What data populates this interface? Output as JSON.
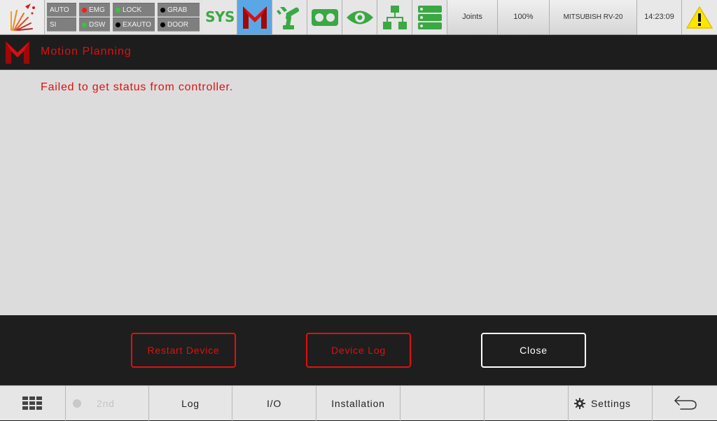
{
  "topbar": {
    "status": {
      "mode_top": "AUTO",
      "mode_bottom": "SI",
      "emg": "EMG",
      "dsw": "DSW",
      "lock": "LOCK",
      "exauto": "EXAUTO",
      "grab": "GRAB",
      "door": "DOOR"
    },
    "sys_label": "SYS",
    "joints_label": "Joints",
    "speed": "100%",
    "robot_name": "MITSUBISH RV-20",
    "time": "14:23:09",
    "icons": [
      "logo-icon",
      "sys-icon",
      "motion-planning-icon",
      "robot-arm-icon",
      "tape-icon",
      "eye-icon",
      "network-icon",
      "list-icon",
      "warning-icon"
    ]
  },
  "title": {
    "text": "Motion Planning"
  },
  "message": {
    "text": "Failed to get status from controller."
  },
  "actions": {
    "restart": "Restart Device",
    "device_log": "Device Log",
    "close": "Close"
  },
  "bottombar": {
    "second": "2nd",
    "log": "Log",
    "io": "I/O",
    "installation": "Installation",
    "settings": "Settings"
  },
  "colors": {
    "accent_red": "#e01010",
    "icon_green": "#3aa843",
    "selected_blue": "#5aa7e6",
    "warning_yellow": "#ffe600"
  }
}
